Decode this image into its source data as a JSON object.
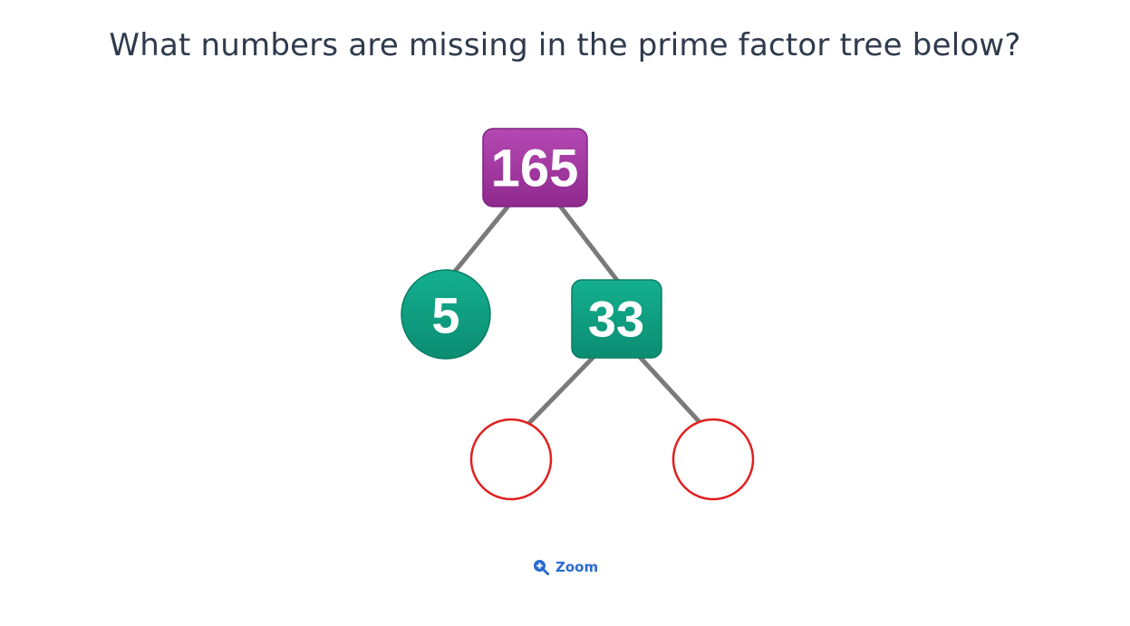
{
  "question": {
    "text": "What numbers are missing in the prime factor tree below?"
  },
  "tree": {
    "root": {
      "value": "165",
      "shape": "rounded-square",
      "color": "#a1359f"
    },
    "left_child": {
      "value": "5",
      "shape": "circle",
      "color": "#0e9a7f"
    },
    "right_child": {
      "value": "33",
      "shape": "rounded-square",
      "color": "#0e9a7f"
    },
    "missing_left": {
      "value": "",
      "shape": "circle",
      "border_color": "#e02020"
    },
    "missing_right": {
      "value": "",
      "shape": "circle",
      "border_color": "#e02020"
    },
    "line_color": "#7a7a7a"
  },
  "zoom": {
    "label": "Zoom",
    "icon": "zoom-in-icon",
    "color": "#2a6bd1"
  }
}
